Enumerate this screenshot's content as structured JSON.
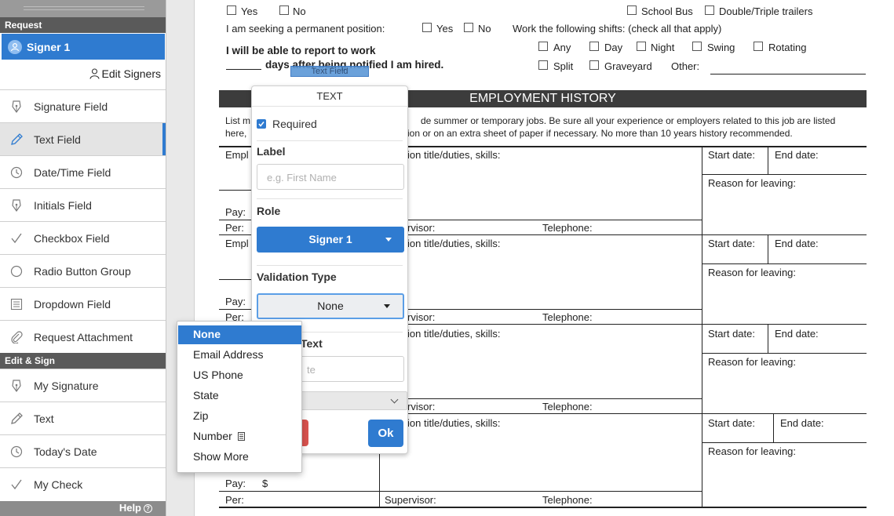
{
  "sidebar": {
    "request_header": "Request",
    "signer": "Signer 1",
    "edit_signers": "Edit Signers",
    "request_items": [
      {
        "label": "Signature Field",
        "icon": "pen-nib-icon"
      },
      {
        "label": "Text Field",
        "icon": "pencil-icon"
      },
      {
        "label": "Date/Time Field",
        "icon": "clock-icon"
      },
      {
        "label": "Initials Field",
        "icon": "pen-nib-icon"
      },
      {
        "label": "Checkbox Field",
        "icon": "checkmark-icon"
      },
      {
        "label": "Radio Button Group",
        "icon": "radio-icon"
      },
      {
        "label": "Dropdown Field",
        "icon": "list-icon"
      },
      {
        "label": "Request Attachment",
        "icon": "paperclip-icon"
      }
    ],
    "edit_sign_header": "Edit & Sign",
    "edit_sign_items": [
      {
        "label": "My Signature",
        "icon": "pen-nib-icon"
      },
      {
        "label": "Text",
        "icon": "pencil-icon"
      },
      {
        "label": "Today's Date",
        "icon": "clock-icon"
      },
      {
        "label": "My Check",
        "icon": "checkmark-icon"
      }
    ],
    "help": "Help"
  },
  "document": {
    "yes1": "Yes",
    "no1": "No",
    "school_bus": "School Bus",
    "double_triple": "Double/Triple trailers",
    "permanent_q": "I am seeking a permanent position:",
    "yes2": "Yes",
    "no2": "No",
    "shifts_q": "Work the following shifts: (check all that apply)",
    "report_line1": "I will be able to report to work",
    "report_line2": "days after being notified I am hired.",
    "shift_any": "Any",
    "shift_day": "Day",
    "shift_night": "Night",
    "shift_swing": "Swing",
    "shift_rotating": "Rotating",
    "shift_split": "Split",
    "shift_graveyard": "Graveyard",
    "other": "Other:",
    "field_tag": "Text Field",
    "section_title": "EMPLOYMENT HISTORY",
    "instr_left1": "List m",
    "instr_right1": "de summer or temporary jobs. Be sure all your experience or employers related to this job are listed",
    "instr_left2": "here,",
    "instr_right2": "ion or on an extra sheet of paper if necessary. No more than 10 years history recommended.",
    "employer": "Empl",
    "position": "ion title/duties, skills:",
    "start_date": "Start date:",
    "end_date": "End date:",
    "reason": "Reason for leaving:",
    "pay": "Pay:",
    "per": "Per:",
    "supervisor_partial": "rvisor:",
    "supervisor": "Supervisor:",
    "telephone": "Telephone:",
    "dollar": "$"
  },
  "popover": {
    "title": "TEXT",
    "required": "Required",
    "label_heading": "Label",
    "label_placeholder": "e.g. First Name",
    "role_heading": "Role",
    "role_value": "Signer 1",
    "validation_heading": "Validation Type",
    "validation_value": "None",
    "default_heading_partial": "Text",
    "default_placeholder_partial": "te",
    "ok": "Ok"
  },
  "dropdown": {
    "options": [
      "None",
      "Email Address",
      "US Phone",
      "State",
      "Zip",
      "Number",
      "Show More"
    ],
    "selected": "None"
  },
  "colors": {
    "accent": "#2f7bd0",
    "section_dark": "#5a5a5a",
    "danger": "#d9534f"
  }
}
